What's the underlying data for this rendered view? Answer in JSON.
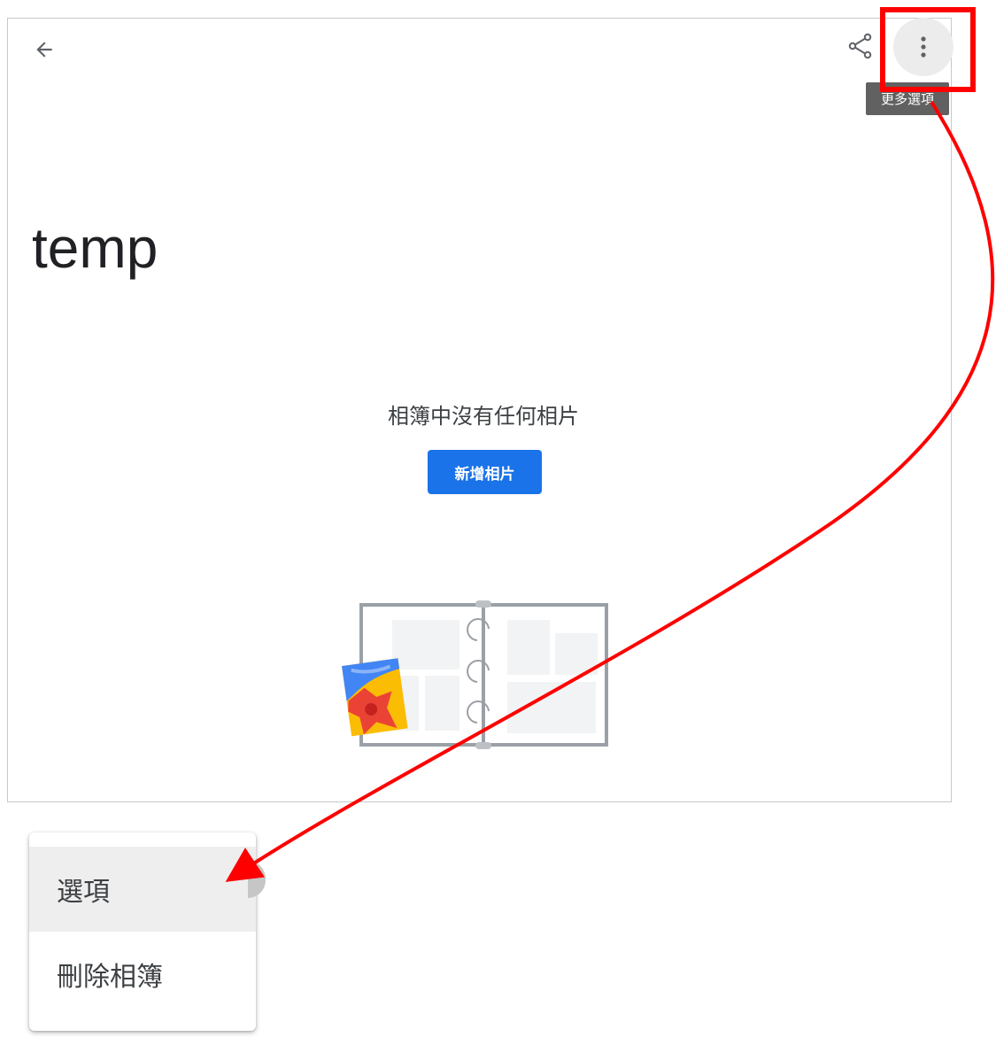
{
  "album": {
    "title": "temp",
    "empty_message": "相簿中沒有任何相片",
    "add_photos_label": "新增相片"
  },
  "toolbar": {
    "back_icon": "arrow-left-icon",
    "share_icon": "share-icon",
    "more_icon": "more-vert-icon",
    "more_tooltip": "更多選項"
  },
  "menu": {
    "items": [
      {
        "label": "選項"
      },
      {
        "label": "刪除相簿"
      }
    ]
  },
  "colors": {
    "accent": "#1a73e8",
    "annotation": "#ff0000",
    "tooltip_bg": "#616161"
  }
}
